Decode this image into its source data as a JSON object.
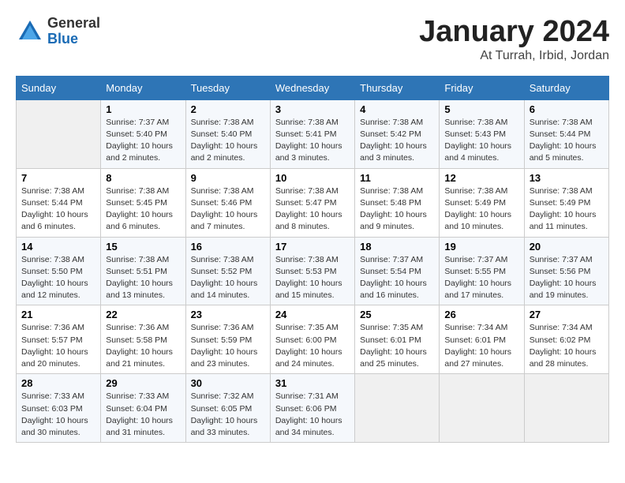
{
  "logo": {
    "general": "General",
    "blue": "Blue"
  },
  "title": "January 2024",
  "location": "At Turrah, Irbid, Jordan",
  "days_header": [
    "Sunday",
    "Monday",
    "Tuesday",
    "Wednesday",
    "Thursday",
    "Friday",
    "Saturday"
  ],
  "weeks": [
    [
      {
        "day": "",
        "content": ""
      },
      {
        "day": "1",
        "content": "Sunrise: 7:37 AM\nSunset: 5:40 PM\nDaylight: 10 hours\nand 2 minutes."
      },
      {
        "day": "2",
        "content": "Sunrise: 7:38 AM\nSunset: 5:40 PM\nDaylight: 10 hours\nand 2 minutes."
      },
      {
        "day": "3",
        "content": "Sunrise: 7:38 AM\nSunset: 5:41 PM\nDaylight: 10 hours\nand 3 minutes."
      },
      {
        "day": "4",
        "content": "Sunrise: 7:38 AM\nSunset: 5:42 PM\nDaylight: 10 hours\nand 3 minutes."
      },
      {
        "day": "5",
        "content": "Sunrise: 7:38 AM\nSunset: 5:43 PM\nDaylight: 10 hours\nand 4 minutes."
      },
      {
        "day": "6",
        "content": "Sunrise: 7:38 AM\nSunset: 5:44 PM\nDaylight: 10 hours\nand 5 minutes."
      }
    ],
    [
      {
        "day": "7",
        "content": "Sunrise: 7:38 AM\nSunset: 5:44 PM\nDaylight: 10 hours\nand 6 minutes."
      },
      {
        "day": "8",
        "content": "Sunrise: 7:38 AM\nSunset: 5:45 PM\nDaylight: 10 hours\nand 6 minutes."
      },
      {
        "day": "9",
        "content": "Sunrise: 7:38 AM\nSunset: 5:46 PM\nDaylight: 10 hours\nand 7 minutes."
      },
      {
        "day": "10",
        "content": "Sunrise: 7:38 AM\nSunset: 5:47 PM\nDaylight: 10 hours\nand 8 minutes."
      },
      {
        "day": "11",
        "content": "Sunrise: 7:38 AM\nSunset: 5:48 PM\nDaylight: 10 hours\nand 9 minutes."
      },
      {
        "day": "12",
        "content": "Sunrise: 7:38 AM\nSunset: 5:49 PM\nDaylight: 10 hours\nand 10 minutes."
      },
      {
        "day": "13",
        "content": "Sunrise: 7:38 AM\nSunset: 5:49 PM\nDaylight: 10 hours\nand 11 minutes."
      }
    ],
    [
      {
        "day": "14",
        "content": "Sunrise: 7:38 AM\nSunset: 5:50 PM\nDaylight: 10 hours\nand 12 minutes."
      },
      {
        "day": "15",
        "content": "Sunrise: 7:38 AM\nSunset: 5:51 PM\nDaylight: 10 hours\nand 13 minutes."
      },
      {
        "day": "16",
        "content": "Sunrise: 7:38 AM\nSunset: 5:52 PM\nDaylight: 10 hours\nand 14 minutes."
      },
      {
        "day": "17",
        "content": "Sunrise: 7:38 AM\nSunset: 5:53 PM\nDaylight: 10 hours\nand 15 minutes."
      },
      {
        "day": "18",
        "content": "Sunrise: 7:37 AM\nSunset: 5:54 PM\nDaylight: 10 hours\nand 16 minutes."
      },
      {
        "day": "19",
        "content": "Sunrise: 7:37 AM\nSunset: 5:55 PM\nDaylight: 10 hours\nand 17 minutes."
      },
      {
        "day": "20",
        "content": "Sunrise: 7:37 AM\nSunset: 5:56 PM\nDaylight: 10 hours\nand 19 minutes."
      }
    ],
    [
      {
        "day": "21",
        "content": "Sunrise: 7:36 AM\nSunset: 5:57 PM\nDaylight: 10 hours\nand 20 minutes."
      },
      {
        "day": "22",
        "content": "Sunrise: 7:36 AM\nSunset: 5:58 PM\nDaylight: 10 hours\nand 21 minutes."
      },
      {
        "day": "23",
        "content": "Sunrise: 7:36 AM\nSunset: 5:59 PM\nDaylight: 10 hours\nand 23 minutes."
      },
      {
        "day": "24",
        "content": "Sunrise: 7:35 AM\nSunset: 6:00 PM\nDaylight: 10 hours\nand 24 minutes."
      },
      {
        "day": "25",
        "content": "Sunrise: 7:35 AM\nSunset: 6:01 PM\nDaylight: 10 hours\nand 25 minutes."
      },
      {
        "day": "26",
        "content": "Sunrise: 7:34 AM\nSunset: 6:01 PM\nDaylight: 10 hours\nand 27 minutes."
      },
      {
        "day": "27",
        "content": "Sunrise: 7:34 AM\nSunset: 6:02 PM\nDaylight: 10 hours\nand 28 minutes."
      }
    ],
    [
      {
        "day": "28",
        "content": "Sunrise: 7:33 AM\nSunset: 6:03 PM\nDaylight: 10 hours\nand 30 minutes."
      },
      {
        "day": "29",
        "content": "Sunrise: 7:33 AM\nSunset: 6:04 PM\nDaylight: 10 hours\nand 31 minutes."
      },
      {
        "day": "30",
        "content": "Sunrise: 7:32 AM\nSunset: 6:05 PM\nDaylight: 10 hours\nand 33 minutes."
      },
      {
        "day": "31",
        "content": "Sunrise: 7:31 AM\nSunset: 6:06 PM\nDaylight: 10 hours\nand 34 minutes."
      },
      {
        "day": "",
        "content": ""
      },
      {
        "day": "",
        "content": ""
      },
      {
        "day": "",
        "content": ""
      }
    ]
  ]
}
